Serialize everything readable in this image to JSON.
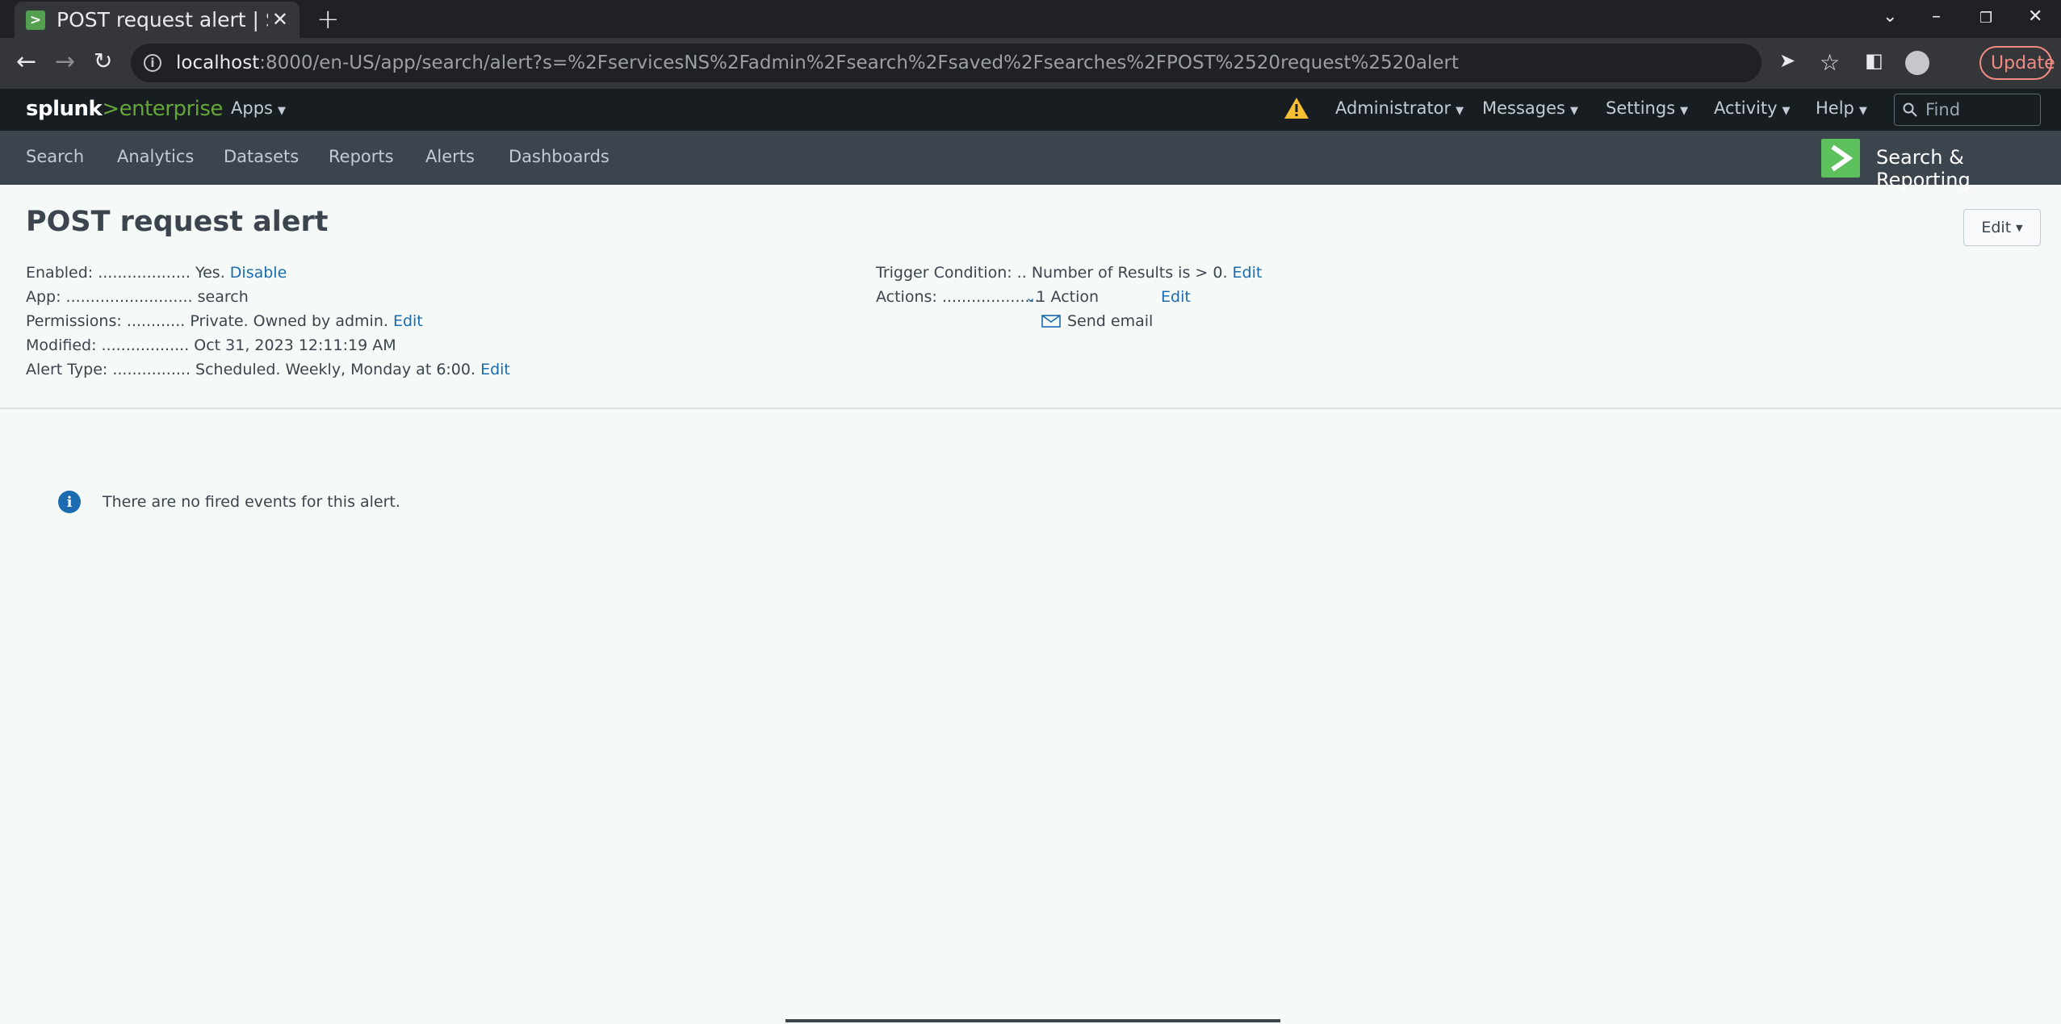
{
  "browser": {
    "tab_title": "POST request alert | Splunk",
    "url_host": "localhost",
    "url_path": ":8000/en-US/app/search/alert?s=%2FservicesNS%2Fadmin%2Fsearch%2Fsaved%2Fsearches%2FPOST%2520request%2520alert",
    "update_label": "Update"
  },
  "splunk": {
    "logo_left": "splunk",
    "logo_right": "enterprise",
    "apps_label": "Apps",
    "menu": [
      "Administrator",
      "Messages",
      "Settings",
      "Activity",
      "Help"
    ],
    "find_placeholder": "Find",
    "nav": [
      "Search",
      "Analytics",
      "Datasets",
      "Reports",
      "Alerts",
      "Dashboards"
    ],
    "app_name": "Search & Reporting"
  },
  "alert": {
    "title": "POST request alert",
    "edit_label": "Edit",
    "enabled_label": "Enabled: ...................",
    "enabled_value": "Yes.",
    "disable_link": "Disable",
    "app_label": "App: ..........................",
    "app_value": "search",
    "permissions_label": "Permissions: ............",
    "permissions_value": "Private. Owned by admin.",
    "modified_label": "Modified: ..................",
    "modified_value": "Oct 31, 2023 12:11:19 AM",
    "type_label": "Alert Type: ................",
    "type_value": "Scheduled. Weekly, Monday at 6:00.",
    "trigger_label": "Trigger Condition: ..",
    "trigger_value": "Number of Results is > 0.",
    "actions_label": "Actions: ....................",
    "actions_value": "1 Action",
    "action_item": "Send email",
    "link_edit": "Edit",
    "no_events": "There are no fired events for this alert."
  }
}
